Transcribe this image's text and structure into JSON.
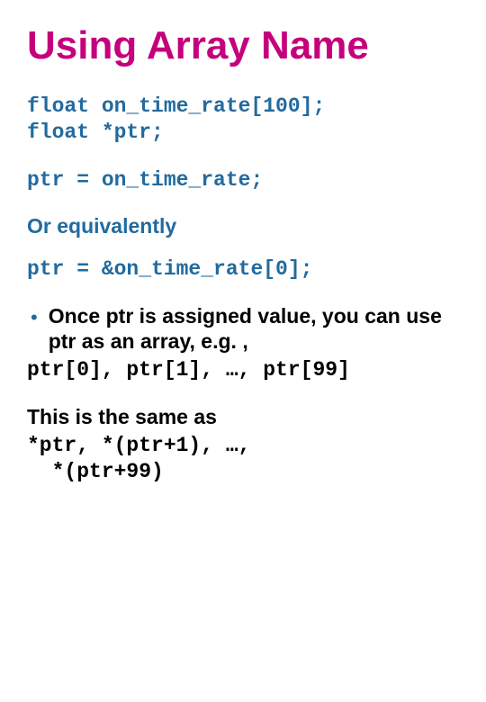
{
  "title": "Using Array Name",
  "code_decl": "float on_time_rate[100];\nfloat *ptr;",
  "code_assign1": "ptr = on_time_rate;",
  "or_equiv": "Or equivalently",
  "code_assign2": "ptr = &on_time_rate[0];",
  "bullet_text": "Once ptr is assigned value, you can use ptr as an array, e.g. ,",
  "code_index": "ptr[0], ptr[1], …, ptr[99]",
  "same_as": "This is the same as",
  "code_deref": "*ptr, *(ptr+1), …,\n  *(ptr+99)"
}
